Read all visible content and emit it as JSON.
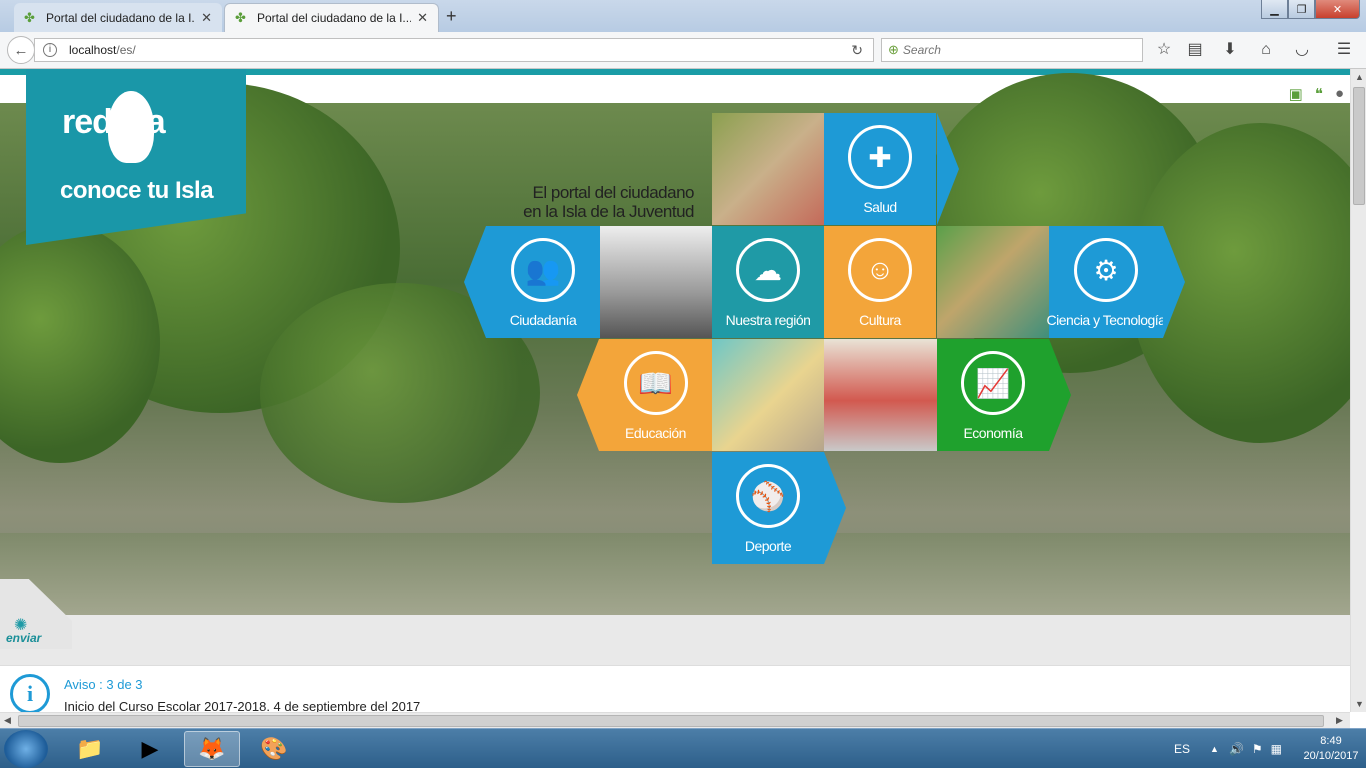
{
  "browser": {
    "tabs": [
      {
        "title": "Portal del ciudadano de la I..."
      },
      {
        "title": "Portal del ciudadano de la I..."
      }
    ],
    "url_host": "localhost",
    "url_path": "/es/",
    "search_placeholder": "Search"
  },
  "site": {
    "logo_title": "red sla",
    "logo_subtitle": "conoce tu Isla",
    "tagline_line1": "El portal del ciudadano",
    "tagline_line2": "en la Isla de la Juventud",
    "tiles": {
      "salud": "Salud",
      "ciudadania": "Ciudadanía",
      "region": "Nuestra región",
      "cultura": "Cultura",
      "ciencia": "Ciencia y Tecnología",
      "educacion": "Educación",
      "economia": "Economía",
      "deporte": "Deporte"
    },
    "enviar": "enviar",
    "aviso_title": "Aviso : 3 de 3",
    "aviso_text": "Inicio del Curso Escolar 2017-2018. 4 de septiembre del 2017"
  },
  "taskbar": {
    "language": "ES",
    "time": "8:49",
    "date": "20/10/2017"
  }
}
